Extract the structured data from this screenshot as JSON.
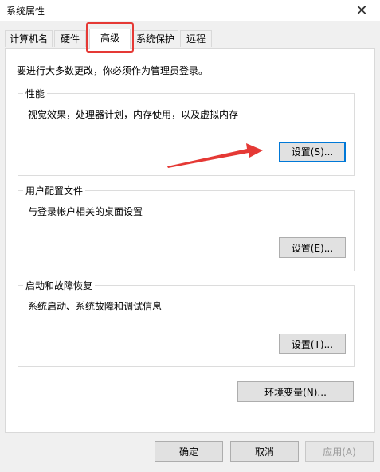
{
  "window": {
    "title": "系统属性",
    "close_icon": "close-icon"
  },
  "tabs": [
    {
      "label": "计算机名"
    },
    {
      "label": "硬件"
    },
    {
      "label": "高级"
    },
    {
      "label": "系统保护"
    },
    {
      "label": "远程"
    }
  ],
  "active_tab": "高级",
  "note": "要进行大多数更改，你必须作为管理员登录。",
  "groups": {
    "performance": {
      "title": "性能",
      "desc": "视觉效果，处理器计划，内存使用，以及虚拟内存",
      "button": "设置(S)..."
    },
    "user_profiles": {
      "title": "用户配置文件",
      "desc": "与登录帐户相关的桌面设置",
      "button": "设置(E)..."
    },
    "startup_recovery": {
      "title": "启动和故障恢复",
      "desc": "系统启动、系统故障和调试信息",
      "button": "设置(T)..."
    }
  },
  "env_button": "环境变量(N)...",
  "footer": {
    "ok": "确定",
    "cancel": "取消",
    "apply": "应用(A)"
  },
  "annotation_color": "#e53935"
}
